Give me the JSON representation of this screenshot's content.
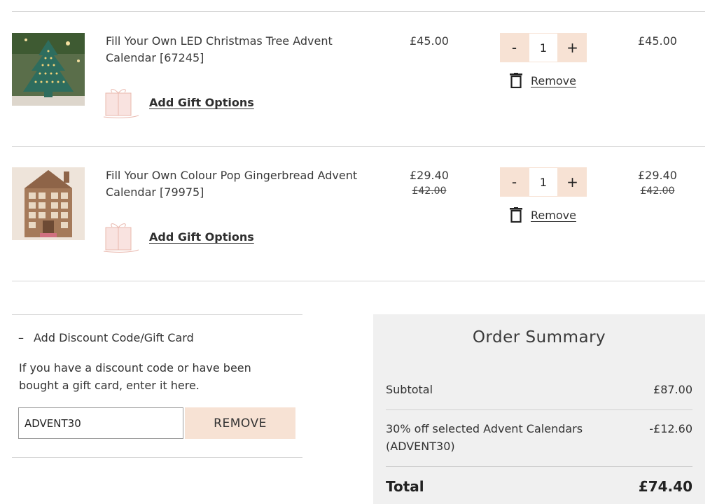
{
  "cart": {
    "items": [
      {
        "title": "Fill Your Own LED Christmas Tree Advent Calendar [67245]",
        "gift_label": "Add Gift Options",
        "unit_price": "£45.00",
        "unit_price_old": "",
        "quantity": "1",
        "total_price": "£45.00",
        "total_price_old": "",
        "remove_label": "Remove"
      },
      {
        "title": "Fill Your Own Colour Pop Gingerbread Advent Calendar [79975]",
        "gift_label": "Add Gift Options",
        "unit_price": "£29.40",
        "unit_price_old": "£42.00",
        "quantity": "1",
        "total_price": "£29.40",
        "total_price_old": "£42.00",
        "remove_label": "Remove"
      }
    ],
    "minus_symbol": "-",
    "plus_symbol": "+"
  },
  "discount": {
    "toggle_symbol": "–",
    "heading": "Add Discount Code/Gift Card",
    "description": "If you have a discount code or have been bought a gift card, enter it here.",
    "code_value": "ADVENT30",
    "button_label": "REMOVE"
  },
  "summary": {
    "title": "Order Summary",
    "subtotal_label": "Subtotal",
    "subtotal_value": "£87.00",
    "discount_label": "30% off selected Advent Calendars (ADVENT30)",
    "discount_value": "-£12.60",
    "total_label": "Total",
    "total_value": "£74.40"
  },
  "colors": {
    "accent": "#f7e2d4",
    "summary_bg": "#f0f0f0"
  }
}
